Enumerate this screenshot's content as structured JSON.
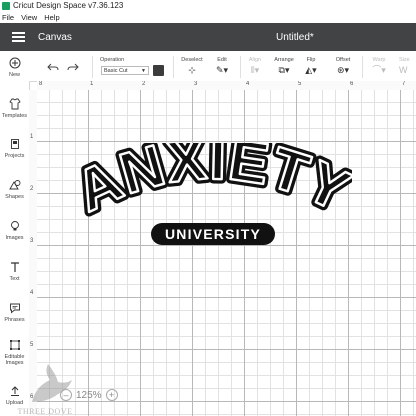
{
  "window": {
    "title": "Cricut Design Space  v7.36.123"
  },
  "menu": [
    "File",
    "View",
    "Help"
  ],
  "header": {
    "section": "Canvas",
    "document_title": "Untitled*"
  },
  "sidebar": [
    {
      "label": "New",
      "icon": "plus-icon"
    },
    {
      "label": "Templates",
      "icon": "shirt-icon"
    },
    {
      "label": "Projects",
      "icon": "projects-icon"
    },
    {
      "label": "Shapes",
      "icon": "shapes-icon"
    },
    {
      "label": "Images",
      "icon": "lightbulb-icon"
    },
    {
      "label": "Text",
      "icon": "text-icon"
    },
    {
      "label": "Phrases",
      "icon": "speech-bubble-icon"
    },
    {
      "label": "Editable Images",
      "icon": "editable-image-icon"
    },
    {
      "label": "Upload",
      "icon": "upload-icon"
    }
  ],
  "toolbar": {
    "operation_label": "Operation",
    "operation_value": "Basic Cut",
    "deselect": "Deselect",
    "edit": "Edit",
    "align": "Align",
    "arrange": "Arrange",
    "flip": "Flip",
    "offset": "Offset",
    "warp": "Warp",
    "size": "Size",
    "swatch_color": "#3c3c3c"
  },
  "ruler": {
    "top": [
      "1",
      "2",
      "3",
      "4",
      "5",
      "6",
      "7",
      "8"
    ],
    "left": [
      "1",
      "2",
      "3",
      "4",
      "5",
      "6",
      "7"
    ]
  },
  "design": {
    "headline": "ANXIETY",
    "subline": "UNIVERSITY"
  },
  "zoom": {
    "level": "125%",
    "minus": "–",
    "plus": "+"
  },
  "watermark": {
    "text": "THREE DOVE"
  }
}
